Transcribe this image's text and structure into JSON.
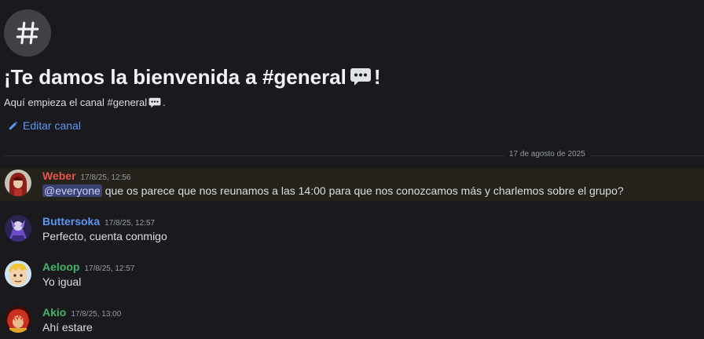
{
  "header": {
    "title_prefix": "¡Te damos la bienvenida a #general",
    "title_suffix": "!",
    "subtitle_prefix": "Aquí empieza el canal #general",
    "subtitle_suffix": ".",
    "edit_label": "Editar canal"
  },
  "date_divider": "17 de agosto de 2025",
  "colors": {
    "weber": "#e8544b",
    "buttersoka": "#5b97f0",
    "green": "#3fb36a",
    "link": "#5b97f0"
  },
  "messages": [
    {
      "author": "Weber",
      "timestamp": "17/8/25, 12:56",
      "mention": "@everyone",
      "text": " que os parece que nos reunamos a las 14:00 para que nos conozcamos más y charlemos sobre el grupo?",
      "avatar_icon": "avatar-red-hooded"
    },
    {
      "author": "Buttersoka",
      "timestamp": "17/8/25, 12:57",
      "text": "Perfecto, cuenta conmigo",
      "avatar_icon": "avatar-purple-figure"
    },
    {
      "author": "Aeloop",
      "timestamp": "17/8/25, 12:57",
      "text": "Yo igual",
      "avatar_icon": "avatar-blonde-cartoon"
    },
    {
      "author": "Akio",
      "timestamp": "17/8/25, 13:00",
      "text": "Ahí estare",
      "avatar_icon": "avatar-red-hair"
    }
  ]
}
